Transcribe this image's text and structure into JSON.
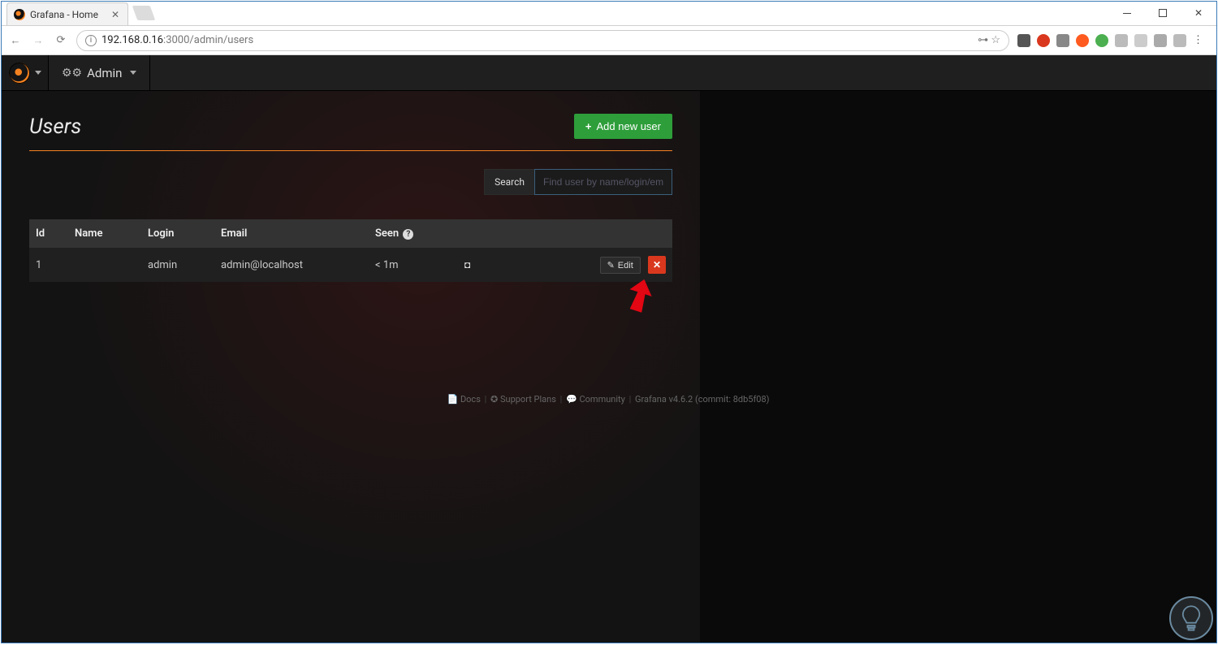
{
  "browser": {
    "tab_title": "Grafana - Home",
    "url_host": "192.168.0.16",
    "url_port_path": ":3000/admin/users"
  },
  "nav": {
    "admin_label": "Admin"
  },
  "page": {
    "title": "Users",
    "add_button": "Add new user",
    "search_label": "Search",
    "search_placeholder": "Find user by name/login/em"
  },
  "table": {
    "headers": {
      "id": "Id",
      "name": "Name",
      "login": "Login",
      "email": "Email",
      "seen": "Seen"
    },
    "rows": [
      {
        "id": "1",
        "name": "",
        "login": "admin",
        "email": "admin@localhost",
        "seen": "< 1m",
        "edit": "Edit"
      }
    ]
  },
  "footer": {
    "docs": "Docs",
    "support": "Support Plans",
    "community": "Community",
    "version": "Grafana v4.6.2 (commit: 8db5f08)"
  }
}
